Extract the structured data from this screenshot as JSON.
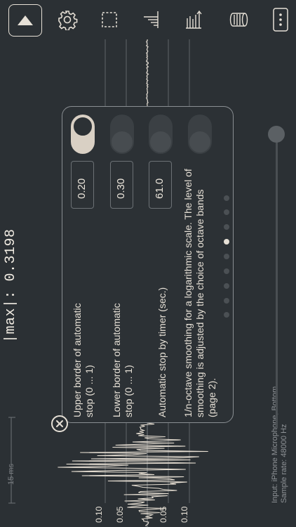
{
  "toolbar": {
    "buttons": [
      {
        "name": "collapse-button",
        "icon": "triangle-up-icon"
      },
      {
        "name": "settings-button",
        "icon": "gear-icon"
      },
      {
        "name": "selection-button",
        "icon": "dashed-square-icon"
      },
      {
        "name": "level-button",
        "icon": "level-scale-icon"
      },
      {
        "name": "bars-button",
        "icon": "bars-arrow-icon"
      },
      {
        "name": "record-button",
        "icon": "cylinder-icon"
      },
      {
        "name": "menu-button",
        "icon": "more-vertical-icon"
      }
    ]
  },
  "scope": {
    "max_readout": "|max|: 0.3198",
    "scale_label": "15 ms",
    "ticks": [
      "0.10",
      "0.05",
      "0.05",
      "0.10"
    ],
    "input": "Input: iPhone Microphone, Bottom",
    "sample_rate": "Sample rate: 48000 Hz",
    "colors": {
      "background": "#2b3034",
      "waveform": "#e8e0d4",
      "grid": "#5f6468"
    }
  },
  "settings_panel": {
    "rows": [
      {
        "label": "Upper border of automatic stop (0 ... 1)",
        "value": "0.20",
        "toggle_on": true
      },
      {
        "label": "Lower border of automatic stop (0 ... 1)",
        "value": "0.30",
        "toggle_on": false
      },
      {
        "label": "Automatic stop by timer (sec.)",
        "value": "61.0",
        "toggle_on": false
      }
    ],
    "extra_toggle_on": false,
    "description": "1/n-octave smoothing for a logarithmic scale. The level of smoothing is adjusted by the choice of octave bands (page 2).",
    "page_count": 9,
    "current_page": 7
  }
}
